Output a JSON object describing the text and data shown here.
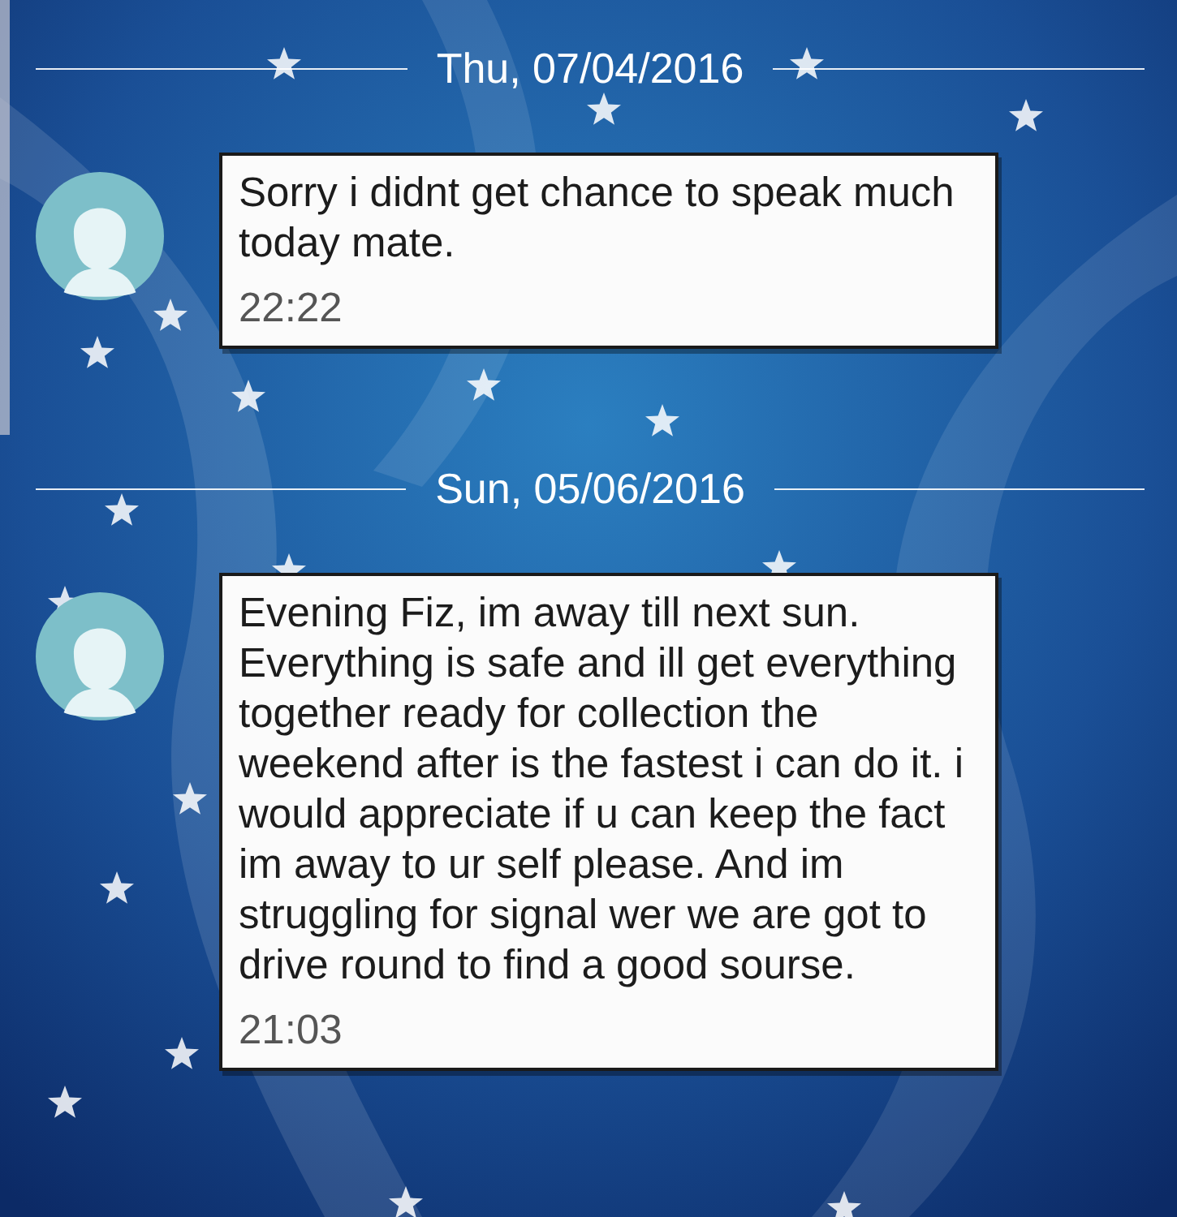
{
  "conversation": [
    {
      "date": "Thu, 07/04/2016",
      "messages": [
        {
          "text": "Sorry i didnt get chance to speak much today mate.",
          "time": "22:22"
        }
      ]
    },
    {
      "date": "Sun, 05/06/2016",
      "messages": [
        {
          "text": "Evening Fiz, im away till next sun. Everything is safe and ill get everything together ready for collection the weekend after is the fastest i can do it. i would appreciate if u can keep the fact im away to ur self please. And im struggling for signal wer we are got to drive round to find a good sourse.",
          "time": "21:03"
        }
      ]
    }
  ]
}
